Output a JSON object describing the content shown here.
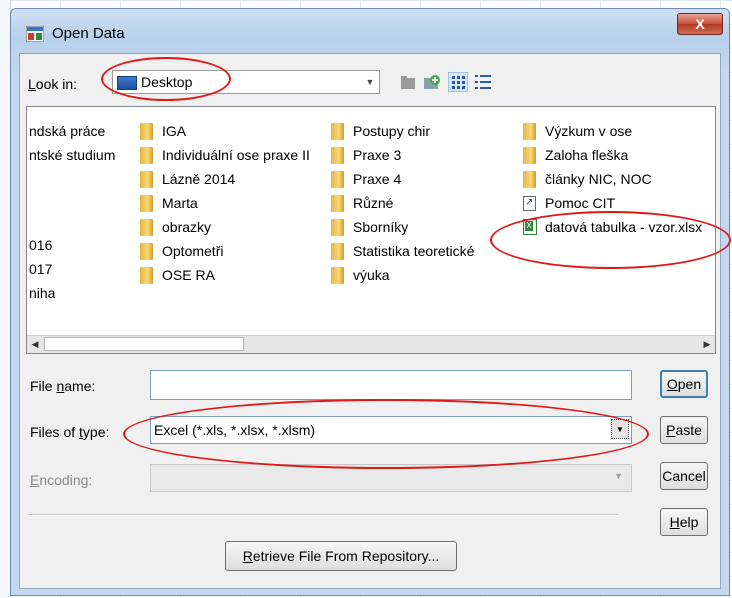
{
  "window": {
    "title": "Open Data",
    "close_label": "X"
  },
  "toolbar": {
    "look_in_label": "Look in:",
    "look_in_value": "Desktop",
    "icons": [
      "up-folder-icon",
      "new-folder-icon",
      "list-view-icon",
      "details-view-icon"
    ]
  },
  "files": {
    "col1": [
      "ndská práce",
      "ntské studium",
      "016",
      "017",
      "niha"
    ],
    "col2": [
      "IGA",
      "Individuální ose praxe II",
      "Lázně 2014",
      "Marta",
      "obrazky",
      "Optometři",
      "OSE RA"
    ],
    "col3": [
      "Postupy chir",
      "Praxe 3",
      "Praxe 4",
      "Různé",
      "Sborníky",
      "Statistika teoretické",
      "výuka"
    ],
    "col4": [
      "Výzkum v ose",
      "Zaloha fleška",
      "články NIC, NOC",
      "Pomoc CIT",
      "datová tabulka - vzor.xlsx"
    ]
  },
  "form": {
    "file_name_label": "File name:",
    "file_name_value": "",
    "files_of_type_label": "Files of type:",
    "files_of_type_value": "Excel (*.xls, *.xlsx, *.xlsm)",
    "encoding_label": "Encoding:",
    "encoding_value": ""
  },
  "buttons": {
    "open": "Open",
    "paste": "Paste",
    "cancel": "Cancel",
    "help": "Help",
    "retrieve": "Retrieve File From Repository..."
  },
  "colors": {
    "annotation": "#e01818",
    "title_gradient": "#b8d0eb",
    "close_button": "#c8503a"
  }
}
